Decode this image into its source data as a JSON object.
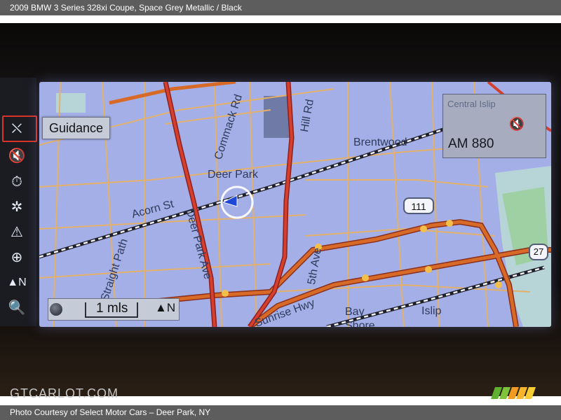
{
  "caption": {
    "top": "2009 BMW 3 Series 328xi Coupe,  Space Grey Metallic / Black",
    "bottom": "Photo Courtesy of Select Motor Cars – Deer Park, NY"
  },
  "watermark": "GTCARLOT.COM",
  "nav": {
    "guidance_label": "Guidance",
    "radio_station": "AM 880",
    "scale_text": "1 mls",
    "north_label": "N",
    "sidebar_icons": [
      {
        "name": "guidance-off-icon",
        "glyph": "⛌"
      },
      {
        "name": "mute-speaker-icon",
        "glyph": "🔇"
      },
      {
        "name": "stopwatch-icon",
        "glyph": "⏱"
      },
      {
        "name": "points-of-interest-icon",
        "glyph": "✲"
      },
      {
        "name": "warning-icon",
        "glyph": "⚠"
      },
      {
        "name": "compass-icon",
        "glyph": "⊕"
      },
      {
        "name": "north-up-icon",
        "glyph": "▲N"
      },
      {
        "name": "zoom-icon",
        "glyph": "🔍"
      }
    ],
    "map_labels": {
      "deer_park": "Deer Park",
      "commack_rd": "Commack Rd",
      "hill_rd": "Hill Rd",
      "brentwood": "Brentwood",
      "acorn_st": "Acorn St",
      "deer_park_ave": "Deer Park Ave",
      "straight_path": "Straight Path",
      "fifth_ave": "5th Ave",
      "sunrise_hwy": "Sunrise Hwy",
      "bay_shore": "Bay Shore",
      "islip": "Islip",
      "central_islip": "Central Islip",
      "route_111": "111",
      "route_27": "27"
    }
  },
  "colors": {
    "map_bg": "#a4afe7",
    "major_road": "#d4402d",
    "highway": "#d86a28",
    "minor_road": "#e3b06a",
    "railroad": "#f2f2f2",
    "water": "#b7d4d7",
    "park": "#9fd0a4"
  }
}
